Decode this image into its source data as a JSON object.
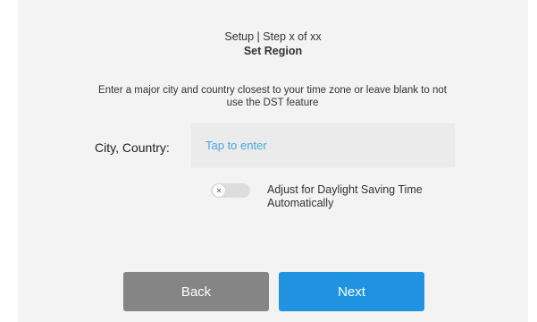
{
  "header": {
    "step_text": "Setup | Step x of xx",
    "title": "Set Region"
  },
  "instructions": "Enter a major city and country closest to your time zone or leave blank to not use the DST feature",
  "city": {
    "label": "City, Country:",
    "value": "",
    "placeholder": "Tap to enter"
  },
  "dst": {
    "label": "Adjust for Daylight Saving Time Automatically",
    "enabled": false,
    "toggle_icon": "x-icon"
  },
  "buttons": {
    "back_label": "Back",
    "next_label": "Next"
  },
  "colors": {
    "background": "#f3f3f3",
    "field_background": "#ebebeb",
    "placeholder": "#45a6de",
    "back_button": "#858585",
    "next_button": "#1f93e0",
    "toggle_off": "#dddddd"
  }
}
